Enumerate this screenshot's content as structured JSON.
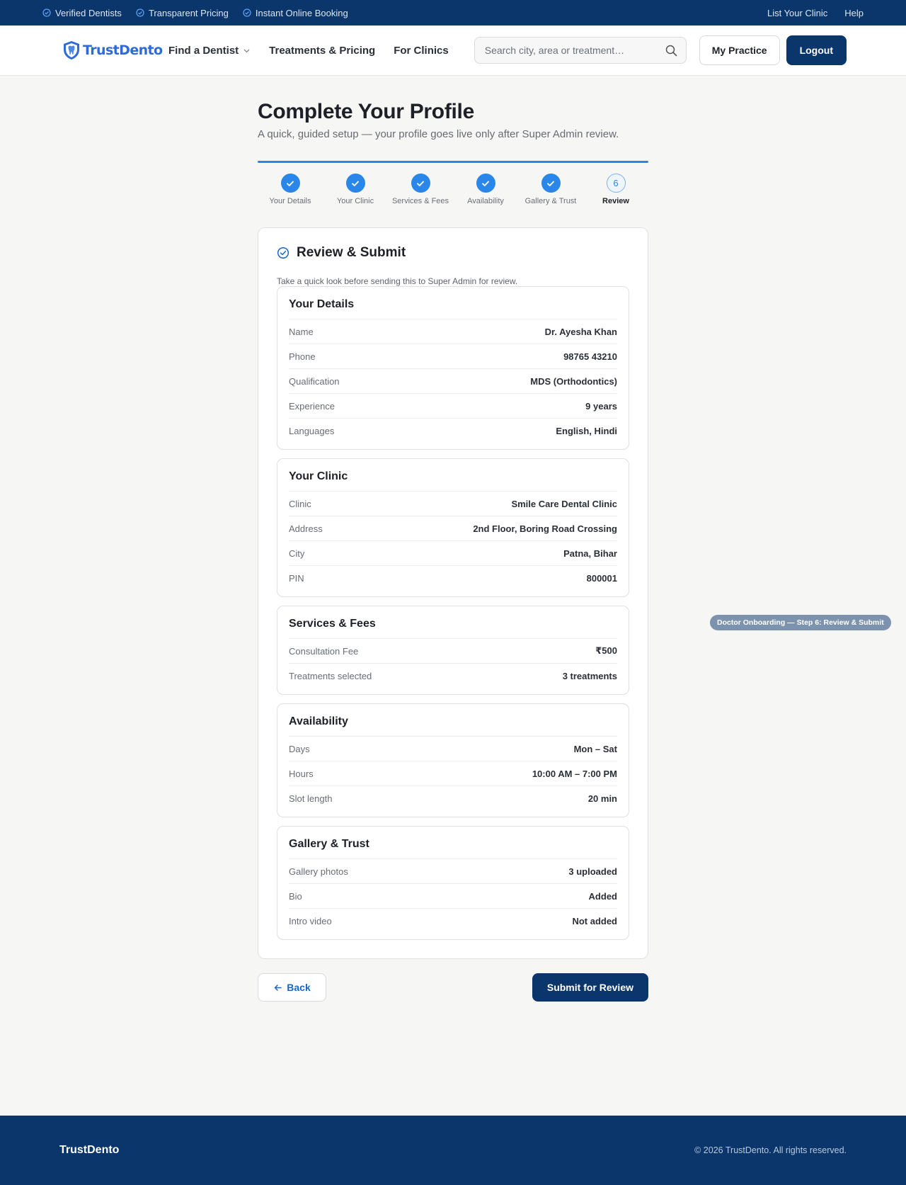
{
  "topbar": {
    "perks": [
      "Verified Dentists",
      "Transparent Pricing",
      "Instant Online Booking"
    ],
    "links": [
      "List Your Clinic",
      "Help"
    ]
  },
  "nav": {
    "brand": "TrustDento",
    "menu": [
      "Find a Dentist",
      "Treatments & Pricing",
      "For Clinics"
    ],
    "search_placeholder": "Search city, area or treatment…",
    "my_practice": "My Practice",
    "logout": "Logout"
  },
  "page": {
    "title": "Complete Your Profile",
    "subtitle": "A quick, guided setup — your profile goes live only after Super Admin review."
  },
  "stepper": {
    "steps": [
      "Your Details",
      "Your Clinic",
      "Services & Fees",
      "Availability",
      "Gallery & Trust",
      "Review"
    ],
    "current_number": "6",
    "completed": 5
  },
  "review": {
    "title": "Review & Submit",
    "description": "Take a quick look before sending this to Super Admin for review.",
    "sections": [
      {
        "title": "Your Details",
        "rows": [
          {
            "label": "Name",
            "value": "Dr. Ayesha Khan"
          },
          {
            "label": "Phone",
            "value": "98765 43210"
          },
          {
            "label": "Qualification",
            "value": "MDS (Orthodontics)"
          },
          {
            "label": "Experience",
            "value": "9 years"
          },
          {
            "label": "Languages",
            "value": "English, Hindi"
          }
        ]
      },
      {
        "title": "Your Clinic",
        "rows": [
          {
            "label": "Clinic",
            "value": "Smile Care Dental Clinic"
          },
          {
            "label": "Address",
            "value": "2nd Floor, Boring Road Crossing"
          },
          {
            "label": "City",
            "value": "Patna, Bihar"
          },
          {
            "label": "PIN",
            "value": "800001"
          }
        ]
      },
      {
        "title": "Services & Fees",
        "rows": [
          {
            "label": "Consultation Fee",
            "value": "₹500"
          },
          {
            "label": "Treatments selected",
            "value": "3 treatments"
          }
        ]
      },
      {
        "title": "Availability",
        "rows": [
          {
            "label": "Days",
            "value": "Mon – Sat"
          },
          {
            "label": "Hours",
            "value": "10:00 AM – 7:00 PM"
          },
          {
            "label": "Slot length",
            "value": "20 min"
          }
        ]
      },
      {
        "title": "Gallery & Trust",
        "rows": [
          {
            "label": "Gallery photos",
            "value": "3 uploaded"
          },
          {
            "label": "Bio",
            "value": "Added"
          },
          {
            "label": "Intro video",
            "value": "Not added"
          }
        ]
      }
    ]
  },
  "actions": {
    "back": "Back",
    "submit": "Submit for Review"
  },
  "tag": "Doctor Onboarding — Step 6: Review & Submit",
  "footer": {
    "brand": "TrustDento",
    "copyright": "© 2026 TrustDento. All rights reserved."
  },
  "colors": {
    "navy": "#0b366b",
    "accent": "#2a86e8",
    "pill": "#7d93ad"
  }
}
